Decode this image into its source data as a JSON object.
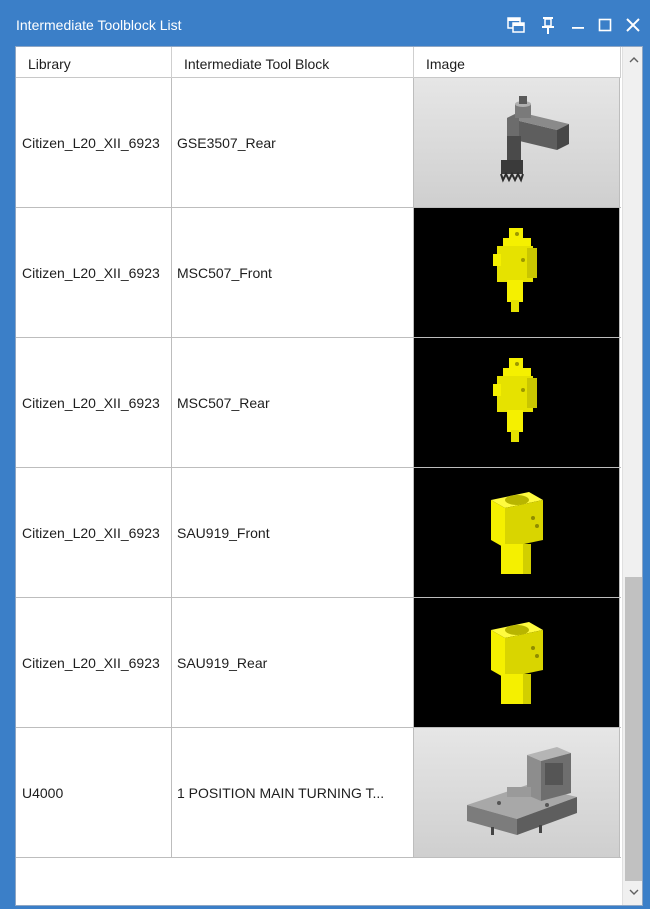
{
  "window": {
    "title": "Intermediate Toolblock List",
    "controls": [
      "dock-icon",
      "pin-icon",
      "minimize-icon",
      "maximize-icon",
      "close-icon"
    ]
  },
  "table": {
    "columns": [
      "Library",
      "Intermediate Tool Block",
      "Image"
    ],
    "rows": [
      {
        "library": "Citizen_L20_XII_6923",
        "tool_block": "GSE3507_Rear",
        "image": "gray-tool-holder-icon"
      },
      {
        "library": "Citizen_L20_XII_6923",
        "tool_block": "MSC507_Front",
        "image": "yellow-tool-block-icon"
      },
      {
        "library": "Citizen_L20_XII_6923",
        "tool_block": "MSC507_Rear",
        "image": "yellow-tool-block-icon"
      },
      {
        "library": "Citizen_L20_XII_6923",
        "tool_block": "SAU919_Front",
        "image": "yellow-sleeve-holder-icon"
      },
      {
        "library": "Citizen_L20_XII_6923",
        "tool_block": "SAU919_Rear",
        "image": "yellow-sleeve-holder-icon"
      },
      {
        "library": "U4000",
        "tool_block": "1 POSITION MAIN TURNING T...",
        "image": "gray-turning-block-icon"
      }
    ]
  },
  "colors": {
    "titlebar": "#3b7fc8",
    "part_yellow": "#f5f000",
    "part_gray": "#7a7a7a"
  }
}
